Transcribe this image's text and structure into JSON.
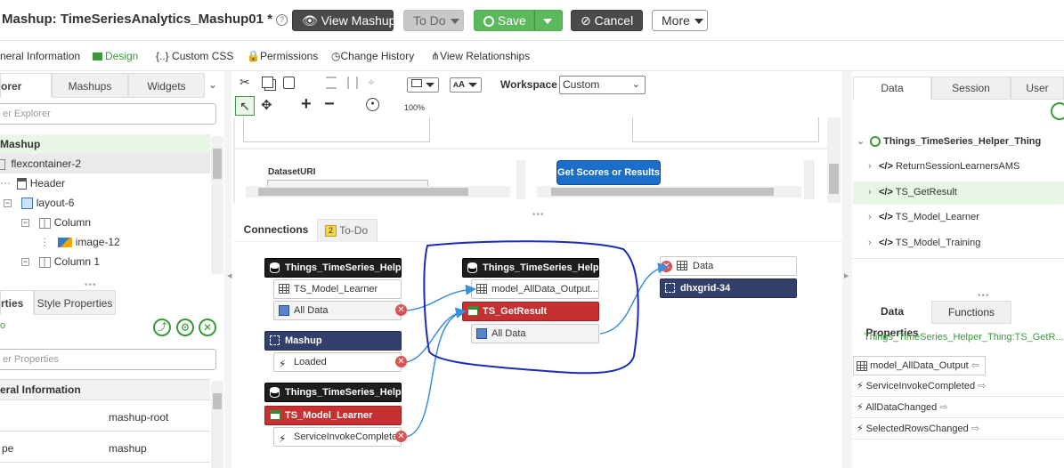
{
  "titlebar": {
    "title": "Mashup: TimeSeriesAnalytics_Mashup01 *",
    "help_icon": "?",
    "view_mashup": "View Mashup",
    "todo": "To Do",
    "save": "Save",
    "cancel": "Cancel",
    "more": "More"
  },
  "tabs": [
    {
      "label": "neral Information"
    },
    {
      "label": "Design"
    },
    {
      "label": "Custom CSS"
    },
    {
      "label": "Permissions"
    },
    {
      "label": "Change History"
    },
    {
      "label": "View Relationships"
    }
  ],
  "left": {
    "tabs": [
      "orer",
      "Mashups",
      "Widgets"
    ],
    "search_placeholder": "er Explorer",
    "tree": [
      "Mashup",
      "flexcontainer-2",
      "Header",
      "layout-6",
      "Column",
      "image-12",
      "Column 1"
    ],
    "props_tabs": [
      "rties",
      "Style Properties"
    ],
    "props_search_placeholder": "er Properties",
    "section": "eral Information",
    "props": [
      {
        "name": "",
        "value": "mashup-root"
      },
      {
        "name": "pe",
        "value": "mashup"
      }
    ]
  },
  "toolbar": {
    "workspace_label": "Workspace",
    "workspace_value": "Custom",
    "zoom": "100%"
  },
  "canvas": {
    "dataset_label": "DatasetURI",
    "button_label": "Get Scores or Results"
  },
  "connections": {
    "tabs": [
      "Connections",
      "To-Do"
    ],
    "todo_badge": "2",
    "nodes": {
      "n1": "Things_TimeSeries_Helper_T...",
      "n1a": "TS_Model_Learner",
      "n1b": "All Data",
      "n2": "Mashup",
      "n2a": "Loaded",
      "n3": "Things_TimeSeries_Helper_T...",
      "n3a": "TS_Model_Learner",
      "n3b": "ServiceInvokeCompleted",
      "m1": "Things_TimeSeries_Helper_T...",
      "m1a": "model_AllData_Output...",
      "m1b": "TS_GetResult",
      "m1c": "All Data",
      "r1": "Data",
      "r2": "dhxgrid-34"
    }
  },
  "right": {
    "tabs": [
      "Data",
      "Session",
      "User"
    ],
    "thing": "Things_TimeSeries_Helper_Thing",
    "services": [
      "ReturnSessionLearnersAMS",
      "TS_GetResult",
      "TS_Model_Learner",
      "TS_Model_Training"
    ],
    "bottom_tabs": [
      "Data Properties",
      "Functions"
    ],
    "selected_service": "Things_TimeSeries_Helper_Thing:TS_GetR...",
    "outputs": [
      "model_AllData_Output",
      "ServiceInvokeCompleted",
      "AllDataChanged",
      "SelectedRowsChanged"
    ]
  },
  "colors": {
    "accent_green": "#5cb85c",
    "node_navy": "#33406b",
    "node_red": "#c63030",
    "wire_blue": "#3a8fd8",
    "annotation_blue": "#1a2bb8"
  }
}
